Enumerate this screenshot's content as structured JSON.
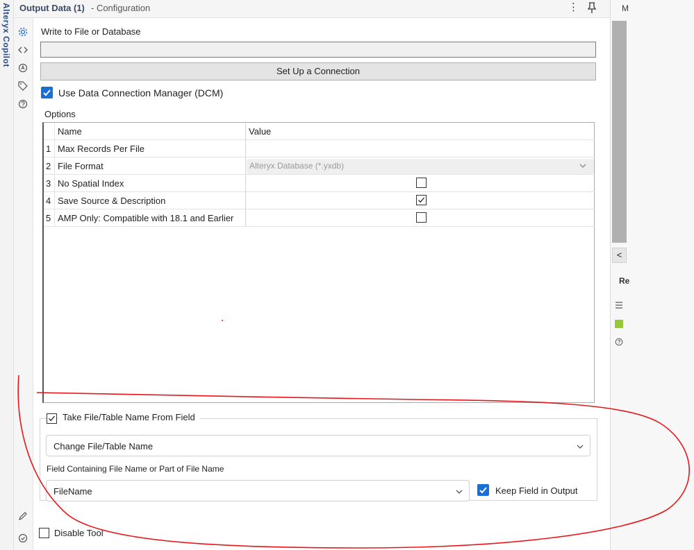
{
  "left_strip": {
    "vertical_text": "Alteryx Copilot"
  },
  "header": {
    "title": "Output Data (1)",
    "subtitle": "- Configuration",
    "menu_glyph": "⋮"
  },
  "icons": {
    "sidebar": [
      "gear-icon",
      "code-icon",
      "annotation-icon",
      "tag-icon",
      "help-icon"
    ],
    "sidebar_bottom": [
      "pencil-icon",
      "check-circle-icon"
    ],
    "colors": {
      "accent": "#1a6fd4",
      "annotation_red": "#e8161b",
      "title": "#3a4a66"
    }
  },
  "form": {
    "write_label": "Write to File or Database",
    "file_value": "",
    "setup_button": "Set Up a Connection",
    "dcm_checked": true,
    "dcm_label": "Use Data Connection Manager (DCM)",
    "options_label": "Options"
  },
  "options_table": {
    "headers": {
      "name": "Name",
      "value": "Value"
    },
    "rows": [
      {
        "num": "1",
        "name": "Max Records Per File",
        "type": "text",
        "value": ""
      },
      {
        "num": "2",
        "name": "File Format",
        "type": "select",
        "value": "Alteryx Database (*.yxdb)"
      },
      {
        "num": "3",
        "name": "No Spatial Index",
        "type": "checkbox",
        "checked": false
      },
      {
        "num": "4",
        "name": "Save Source & Description",
        "type": "checkbox",
        "checked": true
      },
      {
        "num": "5",
        "name": "AMP Only: Compatible with 18.1 and Earlier",
        "type": "checkbox",
        "checked": false
      }
    ]
  },
  "take_file": {
    "checked": true,
    "label": "Take File/Table Name From Field",
    "mode_value": "Change File/Table Name",
    "field_label": "Field Containing File Name or Part of File Name",
    "field_value": "FileName",
    "keep_checked": true,
    "keep_label": "Keep Field in Output"
  },
  "footer": {
    "disable_checked": false,
    "disable_label": "Disable Tool"
  },
  "right_pane": {
    "top_letter": "M",
    "collapse_glyph": "<",
    "section_letter": "Re"
  }
}
